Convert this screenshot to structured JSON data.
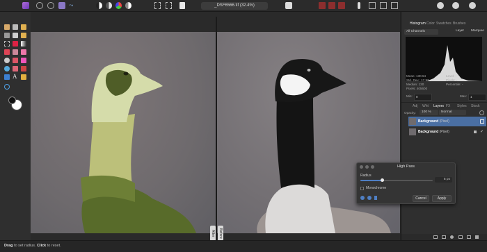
{
  "document": {
    "title": "_DSF6566.tif (32.4%)"
  },
  "panel_tabs_top": [
    "Histogram",
    "Color",
    "Swatches",
    "Brushes"
  ],
  "histogram": {
    "channel": "All Channels",
    "buttons": [
      "Layer",
      "Marquee"
    ],
    "stats_left": [
      "Mean: 130.54",
      "Std. Dev.: 17.93",
      "Median: 130",
      "Pixels: 405600"
    ],
    "stats_right": [
      "Level: -",
      "Pixels: -",
      "Percentile: -"
    ],
    "min_label": "Min:",
    "min_value": "0",
    "max_label": "Max:",
    "max_value": "1"
  },
  "panel_tabs_layers": [
    "Adj",
    "Wht",
    "Layers",
    "FX",
    "Styles",
    "Stock"
  ],
  "layers_opts": {
    "opacity_label": "Opacity:",
    "opacity_value": "100 %",
    "blend_mode": "Normal"
  },
  "layers": [
    {
      "name": "Background",
      "type": "(Pixel)"
    },
    {
      "name": "Background",
      "type": "(Pixel)"
    }
  ],
  "canvas": {
    "after_label": "After",
    "before_label": "Before"
  },
  "dialog": {
    "title": "High Pass",
    "radius_label": "Radius",
    "radius_value": "5 px",
    "radius_fraction": 0.3,
    "monochrome_label": "Monochrome",
    "cancel_label": "Cancel",
    "apply_label": "Apply"
  },
  "status": {
    "drag": "Drag",
    "t1": " to set radius. ",
    "click": "Click",
    "t2": " to reset."
  },
  "colors": {
    "accent": "#4f7fc4",
    "selected_row": "#4a6fa3"
  }
}
